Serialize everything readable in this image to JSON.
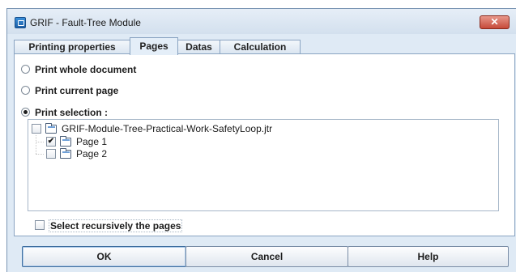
{
  "window": {
    "title": "GRIF - Fault-Tree Module",
    "close_glyph": "✕",
    "app_icon": "app-icon"
  },
  "tabs": [
    {
      "label": "Printing properties",
      "active": false
    },
    {
      "label": "Pages",
      "active": true
    },
    {
      "label": "Datas",
      "active": false
    },
    {
      "label": "Calculation",
      "active": false
    }
  ],
  "print_options": [
    {
      "label": "Print whole document",
      "selected": false
    },
    {
      "label": "Print current page",
      "selected": false
    },
    {
      "label": "Print selection :",
      "selected": true
    }
  ],
  "tree": {
    "root": {
      "label": "GRIF-Module-Tree-Practical-Work-SafetyLoop.jtr",
      "checked": false,
      "icon": "folder-icon"
    },
    "children": [
      {
        "label": "Page 1",
        "checked": true,
        "icon": "folder-icon"
      },
      {
        "label": "Page 2",
        "checked": false,
        "icon": "folder-icon"
      }
    ]
  },
  "recursive": {
    "label": "Select recursively the pages",
    "checked": false
  },
  "buttons": {
    "ok": "OK",
    "cancel": "Cancel",
    "help": "Help"
  },
  "colors": {
    "dialog_bg": "#dfeaf5",
    "close_button": "#c64a3a",
    "accent": "#1c5fa8"
  }
}
